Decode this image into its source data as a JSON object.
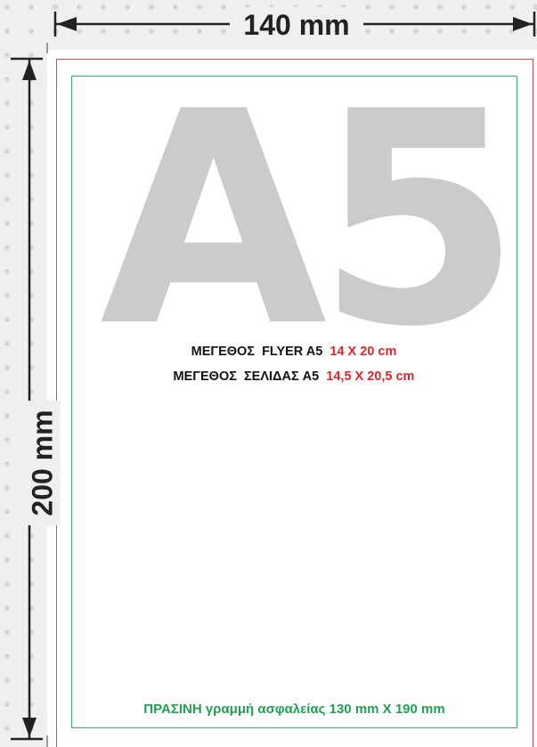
{
  "dimensions": {
    "width_label": "140 mm",
    "height_label": "200 mm"
  },
  "sheet": {
    "big_title": "A5",
    "flyer_size": {
      "label": "ΜΕΓΕΘΟΣ  FLYER A5",
      "value": "14 X 20 cm"
    },
    "page_size": {
      "label": "ΜΕΓΕΘΟΣ  ΣΕΛΙΔΑΣ A5",
      "value": "14,5 X 20,5 cm"
    },
    "safety_note": "ΠΡΑΣΙΝΗ γραμμή ασφαλείας 130 mm X 190 mm"
  },
  "colors": {
    "background": "#efefef",
    "bleed_line": "#e04848",
    "safety_line": "#3aa76d",
    "safety_text": "#1fa052",
    "value_text": "#e0262a",
    "big_title": "#cbcbcb"
  }
}
